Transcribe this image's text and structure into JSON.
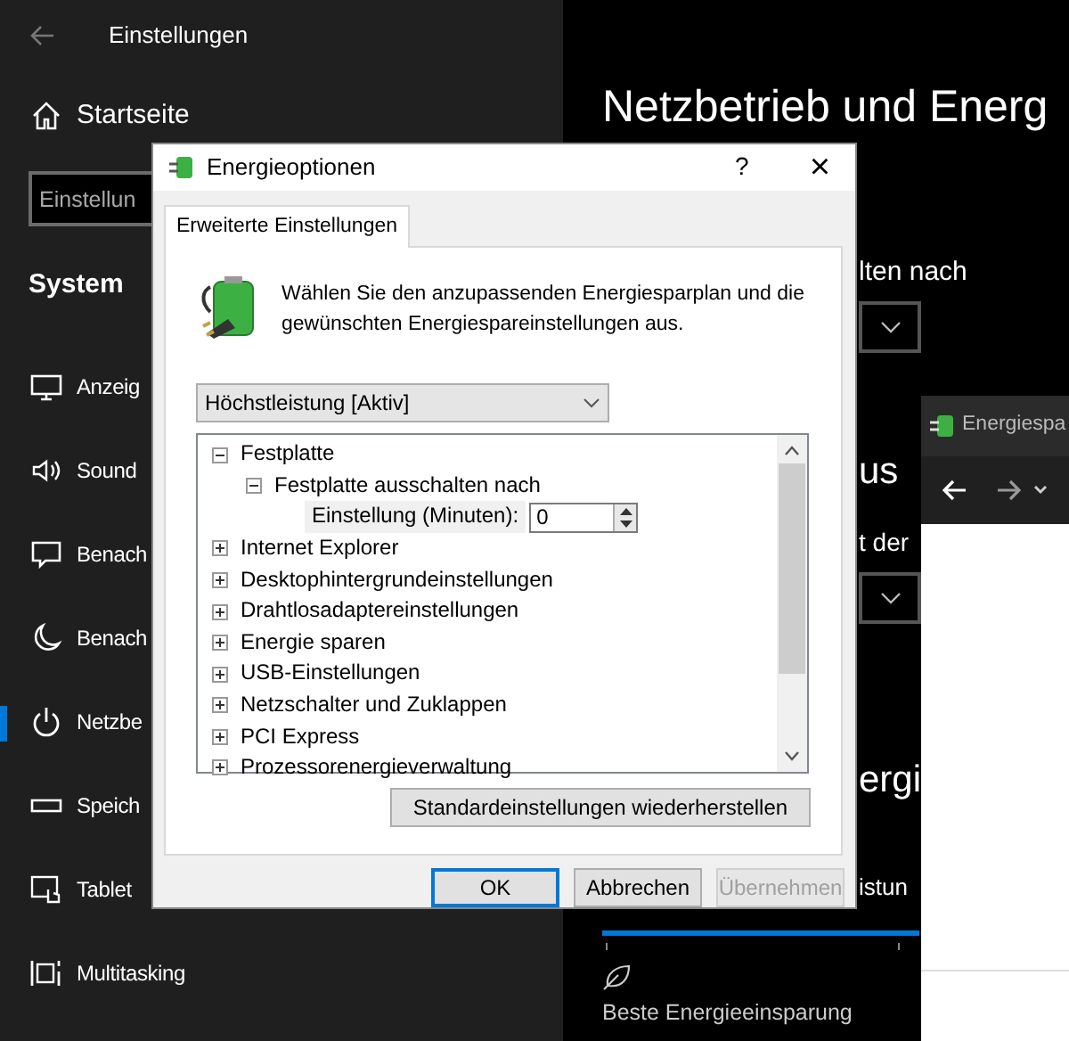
{
  "settings_window": {
    "title": "Einstellungen",
    "home": "Startseite",
    "search": {
      "placeholder": "Einstellun"
    },
    "section": "System",
    "items": [
      {
        "label": "Anzeig",
        "selected": false
      },
      {
        "label": "Sound",
        "selected": false
      },
      {
        "label": "Benach",
        "selected": false
      },
      {
        "label": "Benach",
        "selected": false
      },
      {
        "label": "Netzbe",
        "selected": true
      },
      {
        "label": "Speich",
        "selected": false
      },
      {
        "label": "Tablet",
        "selected": false
      },
      {
        "label": "Multitasking",
        "selected": false
      }
    ],
    "page": {
      "heading": "Netzbetrieb und Energ",
      "text_1": "lten nach",
      "text_2": "us",
      "text_3": "t der",
      "text_4": "ergi",
      "text_5": "istun",
      "slider_label": "Beste Energieeinsparung"
    }
  },
  "dialog": {
    "title": "Energieoptionen",
    "help": "?",
    "close": "×",
    "tabs": [
      {
        "label": "Erweiterte Einstellungen",
        "selected": true
      }
    ],
    "description": "Wählen Sie den anzupassenden Energiesparplan und die gewünschten Energiespareinstellungen aus.",
    "plan": "Höchstleistung [Aktiv]",
    "tree": [
      {
        "label": "Festplatte",
        "expanded": true,
        "children": [
          {
            "label": "Festplatte ausschalten nach",
            "expanded": true,
            "children": [
              {
                "kind": "setting",
                "label": "Einstellung (Minuten):",
                "value": "0"
              }
            ]
          }
        ]
      },
      {
        "label": "Internet Explorer",
        "expanded": false
      },
      {
        "label": "Desktophintergrundeinstellungen",
        "expanded": false
      },
      {
        "label": "Drahtlosadaptereinstellungen",
        "expanded": false
      },
      {
        "label": "Energie sparen",
        "expanded": false
      },
      {
        "label": "USB-Einstellungen",
        "expanded": false
      },
      {
        "label": "Netzschalter und Zuklappen",
        "expanded": false
      },
      {
        "label": "PCI Express",
        "expanded": false
      },
      {
        "label": "Prozessorenergieverwaltung",
        "expanded": false
      }
    ],
    "restore_button": "Standardeinstellungen wiederherstellen",
    "buttons": [
      {
        "label": "OK",
        "default": true,
        "disabled": false
      },
      {
        "label": "Abbrechen",
        "default": false,
        "disabled": false
      },
      {
        "label": "Übernehmen",
        "default": false,
        "disabled": true
      }
    ]
  },
  "explorer_window": {
    "title": "Energiespa"
  }
}
